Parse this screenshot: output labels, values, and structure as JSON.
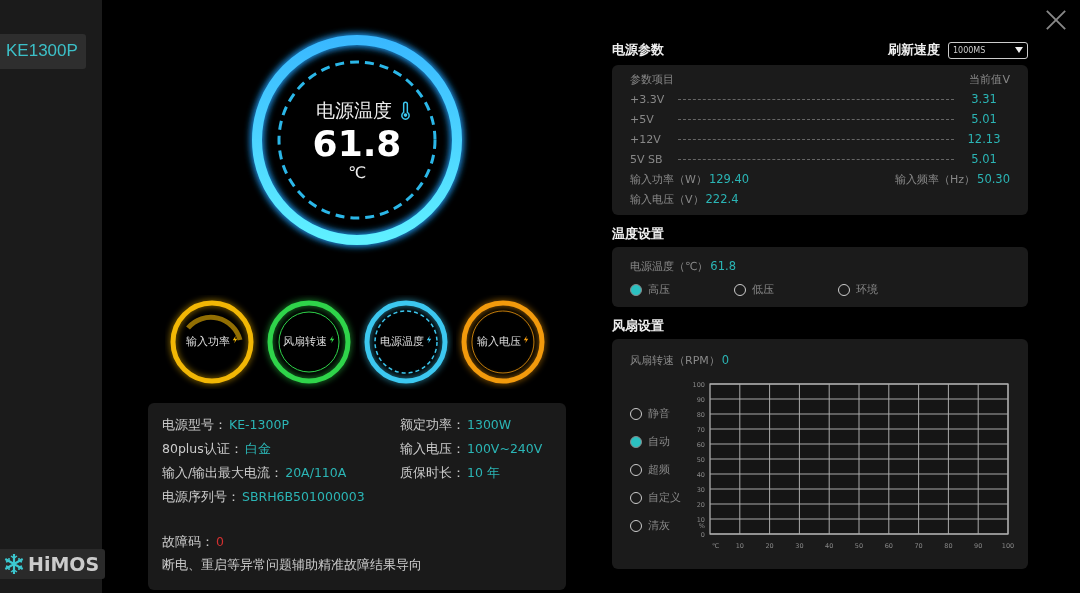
{
  "sidebar": {
    "items": [
      {
        "label": "KE1300P",
        "selected": true
      }
    ],
    "logo": "HiMOS"
  },
  "main_gauge": {
    "title": "电源温度",
    "value": "61.8",
    "unit": "℃"
  },
  "mini_gauges": [
    {
      "label": "输入功率",
      "kind": "power",
      "color": "#f2b705"
    },
    {
      "label": "风扇转速",
      "kind": "fan",
      "color": "#2fd44a"
    },
    {
      "label": "电源温度",
      "kind": "temp",
      "color": "#3cc8f0"
    },
    {
      "label": "输入电压",
      "kind": "voltage",
      "color": "#f29a0c"
    }
  ],
  "info": {
    "fields": [
      {
        "label": "电源型号：",
        "value": "KE-1300P"
      },
      {
        "label": "额定功率：",
        "value": "1300W"
      },
      {
        "label": "80plus认证：",
        "value": "白金"
      },
      {
        "label": "输入电压：",
        "value": "100V~240V"
      },
      {
        "label": "输入/输出最大电流：",
        "value": "20A/110A"
      },
      {
        "label": "质保时长：",
        "value": "10 年"
      },
      {
        "label": "电源序列号：",
        "value": "SBRH6B501000003"
      }
    ],
    "fault_label": "故障码：",
    "fault_code": "0",
    "note": "断电、重启等异常问题辅助精准故障结果导向"
  },
  "power_params": {
    "title": "电源参数",
    "refresh_label": "刷新速度",
    "refresh_value": "1000MS",
    "header": [
      "参数项目",
      "当前值V"
    ],
    "rows": [
      {
        "name": "+3.3V",
        "value": "3.31"
      },
      {
        "name": "+5V",
        "value": "5.01"
      },
      {
        "name": "+12V",
        "value": "12.13"
      },
      {
        "name": "5V SB",
        "value": "5.01"
      }
    ],
    "input_power": {
      "label": "输入功率（W）",
      "value": "129.40"
    },
    "input_freq": {
      "label": "输入频率（Hz）",
      "value": "50.30"
    },
    "input_voltage": {
      "label": "输入电压（V）",
      "value": "222.4"
    }
  },
  "temp_settings": {
    "title": "温度设置",
    "reading_label": "电源温度（℃）",
    "reading": "61.8",
    "options": [
      {
        "label": "高压",
        "selected": true
      },
      {
        "label": "低压",
        "selected": false
      },
      {
        "label": "环境",
        "selected": false
      }
    ]
  },
  "fan_settings": {
    "title": "风扇设置",
    "speed_label": "风扇转速（RPM）",
    "speed": "0",
    "modes": [
      {
        "label": "静音",
        "selected": false
      },
      {
        "label": "自动",
        "selected": true
      },
      {
        "label": "超频",
        "selected": false
      },
      {
        "label": "自定义",
        "selected": false
      },
      {
        "label": "清灰",
        "selected": false
      }
    ],
    "chart_data": {
      "type": "line",
      "grid": true,
      "xlabel": "℃",
      "ylabel": "%",
      "xlim": [
        0,
        100
      ],
      "ylim": [
        0,
        100
      ],
      "xticks": [
        10,
        20,
        30,
        40,
        50,
        60,
        70,
        80,
        90,
        100
      ],
      "yticks": [
        0,
        10,
        20,
        30,
        40,
        50,
        60,
        70,
        80,
        90,
        100
      ]
    }
  }
}
